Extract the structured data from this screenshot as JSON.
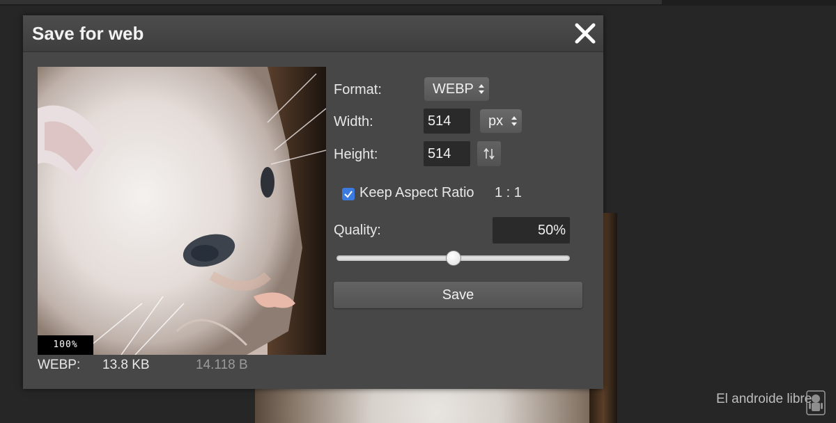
{
  "dialog": {
    "title": "Save for web",
    "close_icon": "close-icon"
  },
  "preview": {
    "zoom": "100%",
    "format": "WEBP:",
    "size_kb": "13.8 KB",
    "size_bytes": "14.118 B"
  },
  "form": {
    "format_label": "Format:",
    "format_value": "WEBP",
    "width_label": "Width:",
    "width_value": "514",
    "unit_value": "px",
    "height_label": "Height:",
    "height_value": "514",
    "keep_aspect_label": "Keep Aspect Ratio",
    "keep_aspect_checked": true,
    "aspect_ratio": "1 : 1",
    "quality_label": "Quality:",
    "quality_value": "50%",
    "quality_level": 0.5,
    "save_label": "Save"
  },
  "watermark": {
    "text": "El androide libre"
  },
  "colors": {
    "dialog_bg": "#474747",
    "checkbox_accent": "#3b7be0",
    "page_bg": "#262626"
  }
}
